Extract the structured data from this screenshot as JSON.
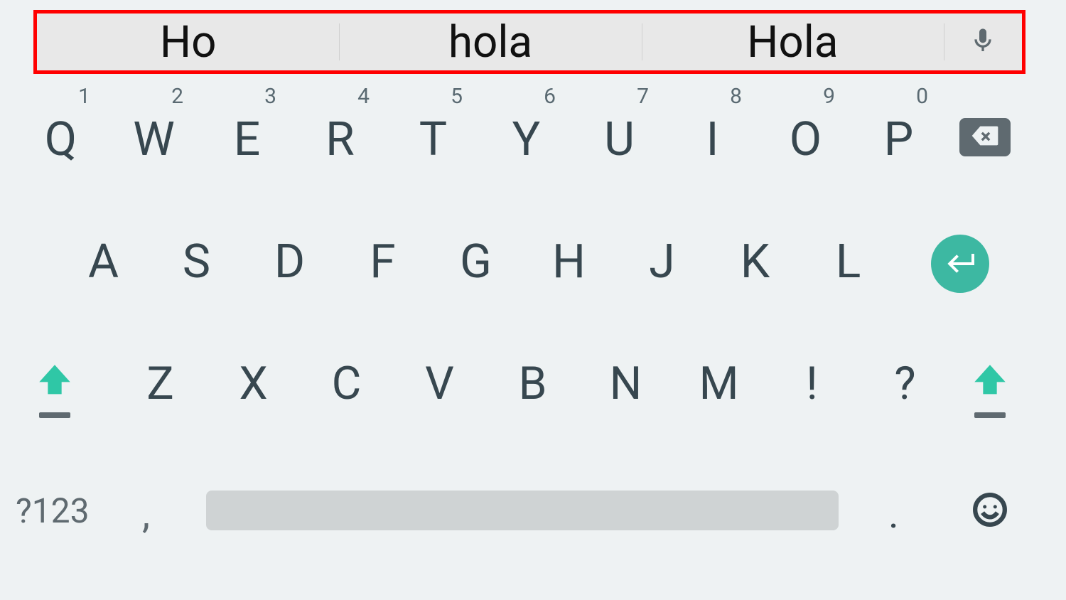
{
  "suggestions": {
    "s1": "Ho",
    "s2": "hola",
    "s3": "Hola"
  },
  "row1": {
    "k0": {
      "n": "1",
      "l": "Q"
    },
    "k1": {
      "n": "2",
      "l": "W"
    },
    "k2": {
      "n": "3",
      "l": "E"
    },
    "k3": {
      "n": "4",
      "l": "R"
    },
    "k4": {
      "n": "5",
      "l": "T"
    },
    "k5": {
      "n": "6",
      "l": "Y"
    },
    "k6": {
      "n": "7",
      "l": "U"
    },
    "k7": {
      "n": "8",
      "l": "I"
    },
    "k8": {
      "n": "9",
      "l": "O"
    },
    "k9": {
      "n": "0",
      "l": "P"
    }
  },
  "row2": {
    "k0": "A",
    "k1": "S",
    "k2": "D",
    "k3": "F",
    "k4": "G",
    "k5": "H",
    "k6": "J",
    "k7": "K",
    "k8": "L"
  },
  "row3": {
    "k0": "Z",
    "k1": "X",
    "k2": "C",
    "k3": "V",
    "k4": "B",
    "k5": "N",
    "k6": "M",
    "k7": "!",
    "k8": "?"
  },
  "bottom": {
    "sym": "?123",
    "comma": ",",
    "period": "."
  }
}
